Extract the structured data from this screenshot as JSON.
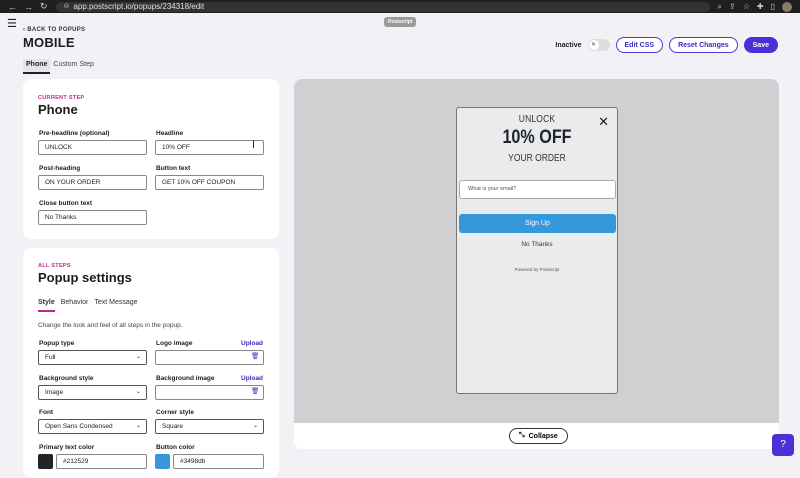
{
  "browser": {
    "url": "app.postscript.io/popups/234318/edit"
  },
  "brand_tag": "Postscript",
  "back_link": "BACK TO POPUPS",
  "page_title": "MOBILE",
  "toolbar": {
    "status_label": "Inactive",
    "edit_css": "Edit CSS",
    "reset": "Reset Changes",
    "save": "Save"
  },
  "tabs": [
    "Phone",
    "Custom Step"
  ],
  "current_step": {
    "eyebrow": "CURRENT STEP",
    "title": "Phone",
    "fields": {
      "preheadline_label": "Pre-headline (optional)",
      "preheadline_value": "UNLOCK",
      "headline_label": "Headline",
      "headline_value": "10% OFF",
      "postheading_label": "Post-heading",
      "postheading_value": "ON YOUR ORDER",
      "button_label": "Button text",
      "button_value": "GET 10% OFF COUPON",
      "close_label": "Close button text",
      "close_value": "No Thanks"
    }
  },
  "popup_settings": {
    "eyebrow": "ALL STEPS",
    "title": "Popup settings",
    "subtabs": [
      "Style",
      "Behavior",
      "Text Message"
    ],
    "description": "Change the look and feel of all steps in the popup.",
    "popup_type_label": "Popup type",
    "popup_type_value": "Full",
    "logo_label": "Logo image",
    "logo_upload": "Upload",
    "bg_style_label": "Background style",
    "bg_style_value": "Image",
    "bg_image_label": "Background image",
    "bg_image_upload": "Upload",
    "font_label": "Font",
    "font_value": "Open Sans Condensed",
    "corner_label": "Corner style",
    "corner_value": "Square",
    "primary_color_label": "Primary text color",
    "primary_color_value": "#212529",
    "button_color_label": "Button color",
    "button_color_value": "#3498db"
  },
  "preview": {
    "pre": "UNLOCK",
    "headline": "10% OFF",
    "post": "YOUR ORDER",
    "email_placeholder": "What is your email?",
    "signup": "Sign Up",
    "no_thanks": "No Thanks",
    "powered": "Powered by  Postscript",
    "collapse": "Collapse"
  },
  "help_icon": "?"
}
